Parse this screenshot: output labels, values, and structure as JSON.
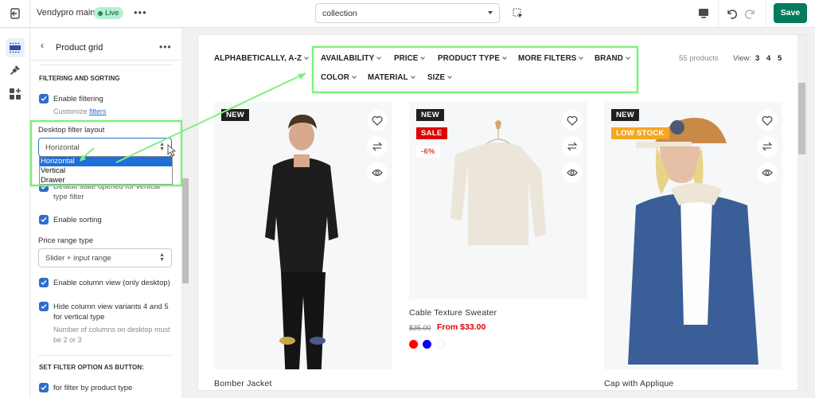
{
  "topbar": {
    "theme_name": "Vendypro main",
    "live_badge": "Live",
    "more_label": "•••",
    "template_select": "collection",
    "save_label": "Save"
  },
  "rail": {
    "items": [
      {
        "name": "sections",
        "active": true
      },
      {
        "name": "theme-settings",
        "active": false
      },
      {
        "name": "apps",
        "active": false
      }
    ]
  },
  "panel": {
    "back_label": "‹",
    "title": "Product grid",
    "more_label": "•••",
    "section_filtering": "FILTERING AND SORTING",
    "enable_filtering": {
      "label": "Enable filtering",
      "checked": true
    },
    "customize_prefix": "Customize",
    "customize_link": "filters",
    "desktop_filter_layout": {
      "label": "Desktop filter layout",
      "value": "Horizontal",
      "options": [
        "Horizontal",
        "Vertical",
        "Drawer"
      ],
      "highlighted": "Horizontal"
    },
    "default_state": {
      "label": "Default state opened for vertical type filter",
      "checked": true
    },
    "enable_sorting": {
      "label": "Enable sorting",
      "checked": true
    },
    "price_range_type": {
      "label": "Price range type",
      "value": "Slider + input range"
    },
    "enable_column_view": {
      "label": "Enable column view (only desktop)",
      "checked": true
    },
    "hide_column_variants": {
      "label": "Hide column view variants 4 and 5 for vertical type",
      "checked": true
    },
    "hide_column_help": "Number of columns on desktop must be 2 or 3",
    "section_button": "SET FILTER OPTION AS BUTTON:",
    "filter_by_type": {
      "label": "for filter by product type",
      "checked": true
    }
  },
  "storefront": {
    "sort_label": "ALPHABETICALLY, A-Z",
    "filters_row1": [
      "AVAILABILITY",
      "PRICE",
      "PRODUCT TYPE",
      "MORE FILTERS",
      "BRAND"
    ],
    "filters_row2": [
      "COLOR",
      "MATERIAL",
      "SIZE"
    ],
    "product_count": "55 products",
    "view_label": "View:",
    "view_options": [
      "3",
      "4",
      "5"
    ],
    "products": [
      {
        "title": "Bomber Jacket",
        "badges": [
          "NEW"
        ]
      },
      {
        "title": "Cable Texture Sweater",
        "badges": [
          "NEW",
          "SALE"
        ],
        "discount": "-6%",
        "old_price": "$35.00",
        "price": "From $33.00",
        "swatches": [
          "#ff0000",
          "#0000ff",
          "#ffffff"
        ]
      },
      {
        "title": "Cap with Applique",
        "badges": [
          "NEW",
          "LOW STOCK"
        ]
      }
    ]
  },
  "colors": {
    "accent_blue": "#2c6ecb",
    "save_green": "#047b5d",
    "annotation_green": "#7ef07e",
    "sale_red": "#e00000",
    "low_stock_orange": "#f5a623"
  }
}
